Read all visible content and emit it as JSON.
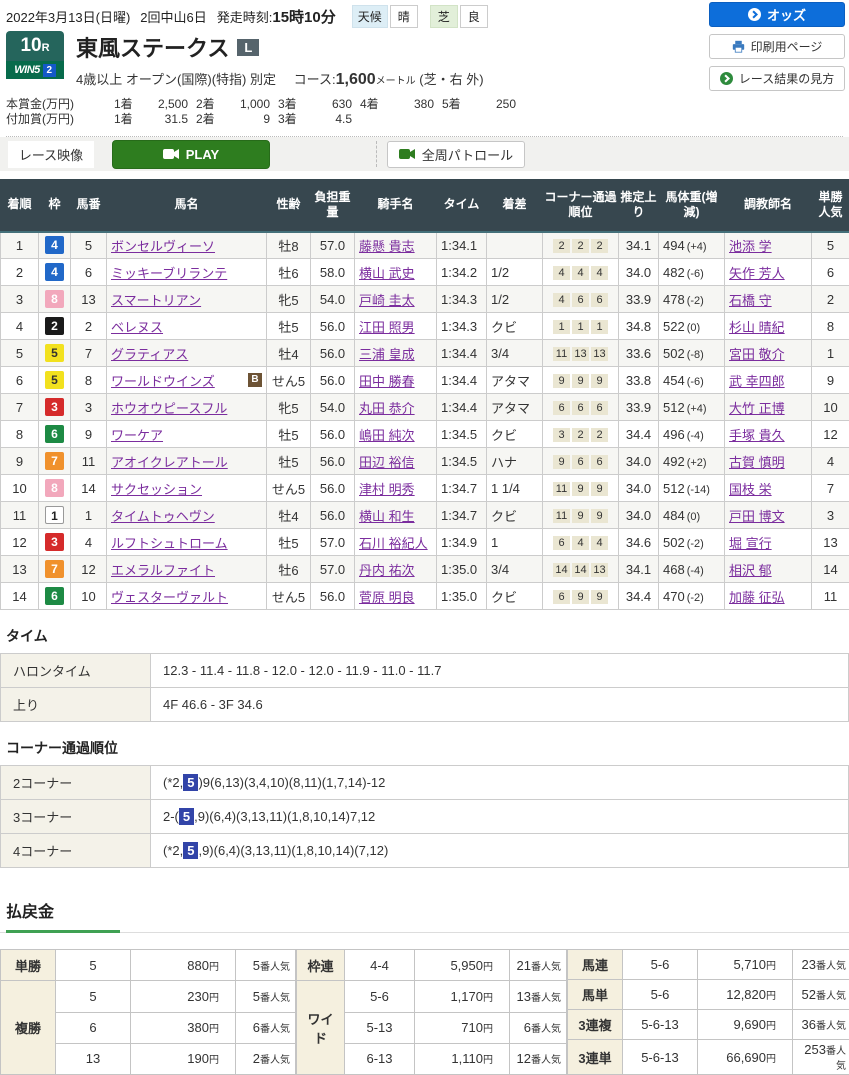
{
  "header": {
    "date": "2022年3月13日(日曜)",
    "meeting": "2回中山6日",
    "start_label": "発走時刻:",
    "start_time": "15時10分",
    "weather_label": "天候",
    "weather": "晴",
    "turf_label": "芝",
    "turf_cond": "良",
    "odds_button": "オッズ",
    "print_button": "印刷用ページ",
    "guide_button": "レース結果の見方"
  },
  "race": {
    "number": "10",
    "number_suffix": "R",
    "win5": "WIN5",
    "win5_num": "2",
    "title": "東風ステークス",
    "grade": "L",
    "conditions": "4歳以上 オープン(国際)(特指) 別定",
    "course_label": "コース:",
    "distance": "1,600",
    "distance_unit": "メートル",
    "course_note": "(芝・右 外)"
  },
  "prizes": {
    "main_label": "本賞金(万円)",
    "main": [
      {
        "rank": "1着",
        "value": "2,500"
      },
      {
        "rank": "2着",
        "value": "1,000"
      },
      {
        "rank": "3着",
        "value": "630"
      },
      {
        "rank": "4着",
        "value": "380"
      },
      {
        "rank": "5着",
        "value": "250"
      }
    ],
    "extra_label": "付加賞(万円)",
    "extra": [
      {
        "rank": "1着",
        "value": "31.5"
      },
      {
        "rank": "2着",
        "value": "9"
      },
      {
        "rank": "3着",
        "value": "4.5"
      }
    ]
  },
  "video": {
    "race_video": "レース映像",
    "play": "PLAY",
    "patrol": "全周パトロール"
  },
  "results": {
    "headers": [
      "着順",
      "枠",
      "馬番",
      "馬名",
      "性齢",
      "負担重量",
      "騎手名",
      "タイム",
      "着差",
      "コーナー通過順位",
      "推定上り",
      "馬体重(増減)",
      "調教師名",
      "単勝人気"
    ],
    "rows": [
      {
        "rank": "1",
        "waku": "4",
        "num": "5",
        "name": "ボンセルヴィーソ",
        "note": "",
        "sex_age": "牡8",
        "weight": "57.0",
        "jockey": "藤懸 貴志",
        "time": "1:34.1",
        "margin": "",
        "c1": "2",
        "c2": "2",
        "c3": "2",
        "last3f": "34.1",
        "hw": "494",
        "hw_diff": "(+4)",
        "trainer": "池添 学",
        "pop": "5"
      },
      {
        "rank": "2",
        "waku": "4",
        "num": "6",
        "name": "ミッキーブリランテ",
        "note": "",
        "sex_age": "牡6",
        "weight": "58.0",
        "jockey": "横山 武史",
        "time": "1:34.2",
        "margin": "1/2",
        "c1": "4",
        "c2": "4",
        "c3": "4",
        "last3f": "34.0",
        "hw": "482",
        "hw_diff": "(-6)",
        "trainer": "矢作 芳人",
        "pop": "6"
      },
      {
        "rank": "3",
        "waku": "8",
        "num": "13",
        "name": "スマートリアン",
        "note": "",
        "sex_age": "牝5",
        "weight": "54.0",
        "jockey": "戸崎 圭太",
        "time": "1:34.3",
        "margin": "1/2",
        "c1": "4",
        "c2": "6",
        "c3": "6",
        "last3f": "33.9",
        "hw": "478",
        "hw_diff": "(-2)",
        "trainer": "石橋 守",
        "pop": "2"
      },
      {
        "rank": "4",
        "waku": "2",
        "num": "2",
        "name": "ベレヌス",
        "note": "",
        "sex_age": "牡5",
        "weight": "56.0",
        "jockey": "江田 照男",
        "time": "1:34.3",
        "margin": "クビ",
        "c1": "1",
        "c2": "1",
        "c3": "1",
        "last3f": "34.8",
        "hw": "522",
        "hw_diff": "(0)",
        "trainer": "杉山 晴紀",
        "pop": "8"
      },
      {
        "rank": "5",
        "waku": "5",
        "num": "7",
        "name": "グラティアス",
        "note": "",
        "sex_age": "牡4",
        "weight": "56.0",
        "jockey": "三浦 皇成",
        "time": "1:34.4",
        "margin": "3/4",
        "c1": "11",
        "c2": "13",
        "c3": "13",
        "last3f": "33.6",
        "hw": "502",
        "hw_diff": "(-8)",
        "trainer": "宮田 敬介",
        "pop": "1"
      },
      {
        "rank": "6",
        "waku": "5",
        "num": "8",
        "name": "ワールドウインズ",
        "note": "B",
        "sex_age": "せん5",
        "weight": "56.0",
        "jockey": "田中 勝春",
        "time": "1:34.4",
        "margin": "アタマ",
        "c1": "9",
        "c2": "9",
        "c3": "9",
        "last3f": "33.8",
        "hw": "454",
        "hw_diff": "(-6)",
        "trainer": "武 幸四郎",
        "pop": "9"
      },
      {
        "rank": "7",
        "waku": "3",
        "num": "3",
        "name": "ホウオウピースフル",
        "note": "",
        "sex_age": "牝5",
        "weight": "54.0",
        "jockey": "丸田 恭介",
        "time": "1:34.4",
        "margin": "アタマ",
        "c1": "6",
        "c2": "6",
        "c3": "6",
        "last3f": "33.9",
        "hw": "512",
        "hw_diff": "(+4)",
        "trainer": "大竹 正博",
        "pop": "10"
      },
      {
        "rank": "8",
        "waku": "6",
        "num": "9",
        "name": "ワーケア",
        "note": "",
        "sex_age": "牡5",
        "weight": "56.0",
        "jockey": "嶋田 純次",
        "time": "1:34.5",
        "margin": "クビ",
        "c1": "3",
        "c2": "2",
        "c3": "2",
        "last3f": "34.4",
        "hw": "496",
        "hw_diff": "(-4)",
        "trainer": "手塚 貴久",
        "pop": "12"
      },
      {
        "rank": "9",
        "waku": "7",
        "num": "11",
        "name": "アオイクレアトール",
        "note": "",
        "sex_age": "牡5",
        "weight": "56.0",
        "jockey": "田辺 裕信",
        "time": "1:34.5",
        "margin": "ハナ",
        "c1": "9",
        "c2": "6",
        "c3": "6",
        "last3f": "34.0",
        "hw": "492",
        "hw_diff": "(+2)",
        "trainer": "古賀 慎明",
        "pop": "4"
      },
      {
        "rank": "10",
        "waku": "8",
        "num": "14",
        "name": "サクセッション",
        "note": "",
        "sex_age": "せん5",
        "weight": "56.0",
        "jockey": "津村 明秀",
        "time": "1:34.7",
        "margin": "1 1/4",
        "c1": "11",
        "c2": "9",
        "c3": "9",
        "last3f": "34.0",
        "hw": "512",
        "hw_diff": "(-14)",
        "trainer": "国枝 栄",
        "pop": "7"
      },
      {
        "rank": "11",
        "waku": "1",
        "num": "1",
        "name": "タイムトゥヘヴン",
        "note": "",
        "sex_age": "牡4",
        "weight": "56.0",
        "jockey": "横山 和生",
        "time": "1:34.7",
        "margin": "クビ",
        "c1": "11",
        "c2": "9",
        "c3": "9",
        "last3f": "34.0",
        "hw": "484",
        "hw_diff": "(0)",
        "trainer": "戸田 博文",
        "pop": "3"
      },
      {
        "rank": "12",
        "waku": "3",
        "num": "4",
        "name": "ルフトシュトローム",
        "note": "",
        "sex_age": "牡5",
        "weight": "57.0",
        "jockey": "石川 裕紀人",
        "time": "1:34.9",
        "margin": "1",
        "c1": "6",
        "c2": "4",
        "c3": "4",
        "last3f": "34.6",
        "hw": "502",
        "hw_diff": "(-2)",
        "trainer": "堀 宣行",
        "pop": "13"
      },
      {
        "rank": "13",
        "waku": "7",
        "num": "12",
        "name": "エメラルファイト",
        "note": "",
        "sex_age": "牡6",
        "weight": "57.0",
        "jockey": "丹内 祐次",
        "time": "1:35.0",
        "margin": "3/4",
        "c1": "14",
        "c2": "14",
        "c3": "13",
        "last3f": "34.1",
        "hw": "468",
        "hw_diff": "(-4)",
        "trainer": "相沢 郁",
        "pop": "14"
      },
      {
        "rank": "14",
        "waku": "6",
        "num": "10",
        "name": "ヴェスターヴァルト",
        "note": "",
        "sex_age": "せん5",
        "weight": "56.0",
        "jockey": "菅原 明良",
        "time": "1:35.0",
        "margin": "クビ",
        "c1": "6",
        "c2": "9",
        "c3": "9",
        "last3f": "34.4",
        "hw": "470",
        "hw_diff": "(-2)",
        "trainer": "加藤 征弘",
        "pop": "11"
      }
    ]
  },
  "time_section": {
    "title": "タイム",
    "rows": [
      {
        "label": "ハロンタイム",
        "value": "12.3 - 11.4 - 11.8 - 12.0 - 12.0 - 11.9 - 11.0 - 11.7"
      },
      {
        "label": "上り",
        "value": "4F 46.6 - 3F 34.6"
      }
    ]
  },
  "corner_section": {
    "title": "コーナー通過順位",
    "rows": [
      {
        "label": "2コーナー",
        "pre": "(*2,",
        "highlight": "5",
        "post": ")9(6,13)(3,4,10)(8,11)(1,7,14)-12"
      },
      {
        "label": "3コーナー",
        "pre": "2-(",
        "highlight": "5",
        "post": ",9)(6,4)(3,13,11)(1,8,10,14)7,12"
      },
      {
        "label": "4コーナー",
        "pre": "(*2,",
        "highlight": "5",
        "post": ",9)(6,4)(3,13,11)(1,8,10,14)(7,12)"
      }
    ]
  },
  "payout": {
    "title": "払戻金",
    "yen": "円",
    "ninki": "番人気",
    "tansho_label": "単勝",
    "tansho": {
      "num": "5",
      "amount": "880",
      "pop": "5"
    },
    "fukusho_label": "複勝",
    "fukusho": [
      {
        "num": "5",
        "amount": "230",
        "pop": "5"
      },
      {
        "num": "6",
        "amount": "380",
        "pop": "6"
      },
      {
        "num": "13",
        "amount": "190",
        "pop": "2"
      }
    ],
    "wakuren_label": "枠連",
    "wakuren": {
      "num": "4-4",
      "amount": "5,950",
      "pop": "21"
    },
    "wide_label": "ワイド",
    "wide": [
      {
        "num": "5-6",
        "amount": "1,170",
        "pop": "13"
      },
      {
        "num": "5-13",
        "amount": "710",
        "pop": "6"
      },
      {
        "num": "6-13",
        "amount": "1,110",
        "pop": "12"
      }
    ],
    "umaren_label": "馬連",
    "umaren": {
      "num": "5-6",
      "amount": "5,710",
      "pop": "23"
    },
    "umatan_label": "馬単",
    "umatan": {
      "num": "5-6",
      "amount": "12,820",
      "pop": "52"
    },
    "sanfuku_label": "3連複",
    "sanfuku": {
      "num": "5-6-13",
      "amount": "9,690",
      "pop": "36"
    },
    "santan_label": "3連単",
    "santan": {
      "num": "5-6-13",
      "amount": "66,690",
      "pop": "253"
    }
  }
}
